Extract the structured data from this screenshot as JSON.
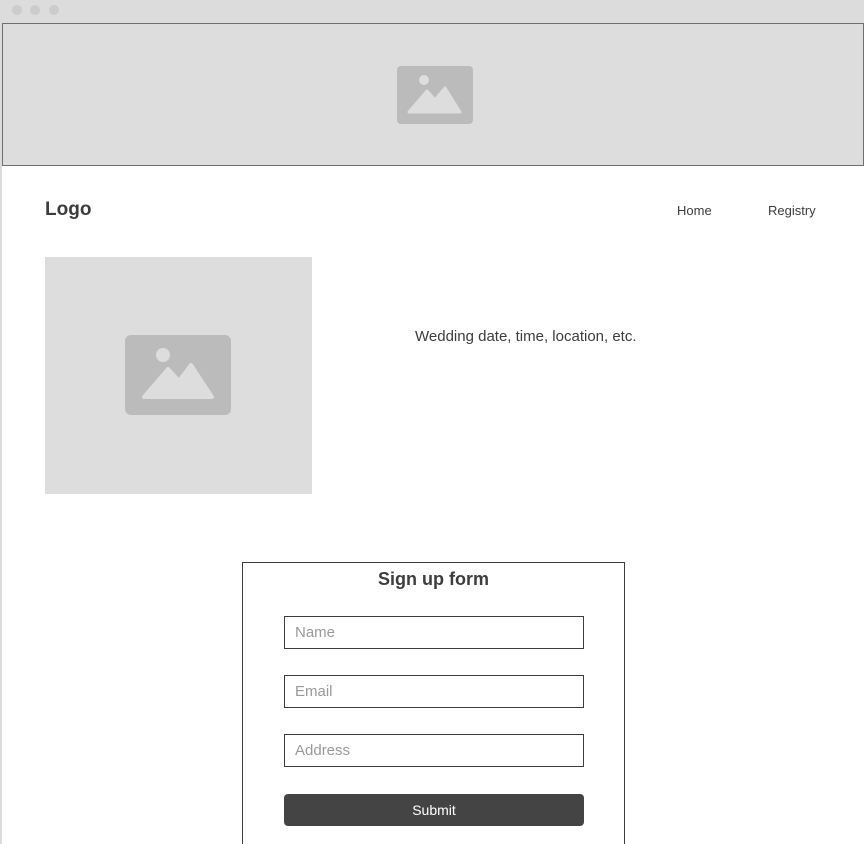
{
  "header": {
    "logo": "Logo",
    "nav": [
      {
        "label": "Home"
      },
      {
        "label": "Registry"
      }
    ]
  },
  "hero": {
    "image_icon": "image-placeholder-icon"
  },
  "details": {
    "text": "Wedding date, time, location, etc."
  },
  "signup_form": {
    "title": "Sign up form",
    "fields": [
      {
        "placeholder": "Name"
      },
      {
        "placeholder": "Email"
      },
      {
        "placeholder": "Address"
      }
    ],
    "submit_label": "Submit"
  },
  "colors": {
    "placeholder_fill": "#dddddd",
    "icon_fill": "#bbbbbb",
    "text": "#3d3d3d",
    "button": "#444444"
  }
}
